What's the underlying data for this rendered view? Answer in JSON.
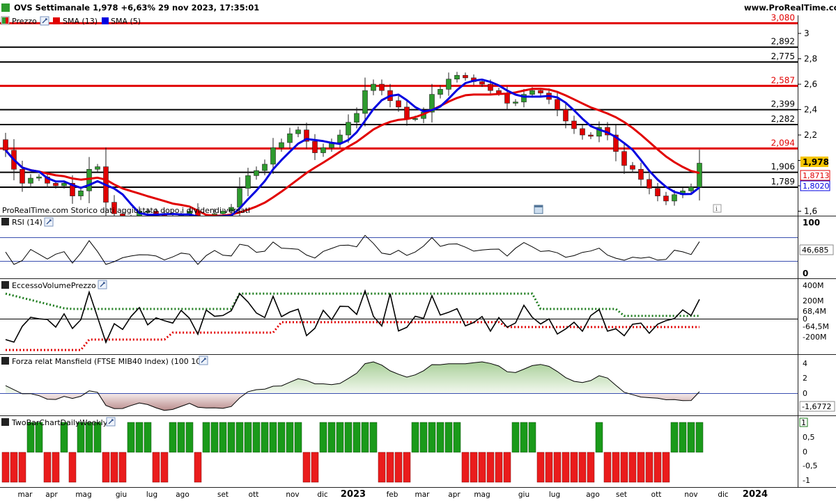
{
  "header": {
    "title": "OVS Settimanale 1,978 +6,63% 29 nov 2023, 17:35:01",
    "site": "www.ProRealTime.com"
  },
  "legend": {
    "price": "Prezzo",
    "sma13": "SMA (13)",
    "sma5": "SMA (5)"
  },
  "watermark": "ProRealTime.com  Storico dati aggiustato dopo i dividendi versati",
  "panels": {
    "rsi": {
      "title": "RSI (14)",
      "top": "100",
      "bottom": "0",
      "value": "46,685"
    },
    "volume": {
      "title": "EccessoVolumePrezzo",
      "ticks": [
        "400M",
        "200M",
        "0",
        "-200M"
      ],
      "upper": "68,4M",
      "lower": "-64,5M"
    },
    "mansfield": {
      "title": "Forza relat Mansfield (FTSE MIB40 Index) (100 10)",
      "ticks": [
        "4",
        "2",
        "0",
        "-2"
      ],
      "value": "-1,6772"
    },
    "twobar": {
      "title": "TwoBarChartDailyWeekly",
      "ticks": [
        "0,5",
        "0",
        "-0,5",
        "-1"
      ],
      "value": "1"
    }
  },
  "axis": {
    "months": [
      {
        "label": "mar",
        "bold": false
      },
      {
        "label": "apr",
        "bold": false
      },
      {
        "label": "mag",
        "bold": false
      },
      {
        "label": "giu",
        "bold": false
      },
      {
        "label": "lug",
        "bold": false
      },
      {
        "label": "ago",
        "bold": false
      },
      {
        "label": "set",
        "bold": false
      },
      {
        "label": "ott",
        "bold": false
      },
      {
        "label": "nov",
        "bold": false
      },
      {
        "label": "dic",
        "bold": false
      },
      {
        "label": "2023",
        "bold": true
      },
      {
        "label": "feb",
        "bold": false
      },
      {
        "label": "mar",
        "bold": false
      },
      {
        "label": "apr",
        "bold": false
      },
      {
        "label": "mag",
        "bold": false
      },
      {
        "label": "giu",
        "bold": false
      },
      {
        "label": "lug",
        "bold": false
      },
      {
        "label": "ago",
        "bold": false
      },
      {
        "label": "set",
        "bold": false
      },
      {
        "label": "ott",
        "bold": false
      },
      {
        "label": "nov",
        "bold": false
      },
      {
        "label": "dic",
        "bold": false
      },
      {
        "label": "2024",
        "bold": true
      }
    ]
  },
  "chart_data": {
    "type": "candlestick",
    "ylim": [
      1.6,
      3.1
    ],
    "yticks": [
      "3",
      "2,8",
      "2,6",
      "2,4",
      "2,2",
      "2",
      "1,8",
      "1,6"
    ],
    "levels": [
      {
        "value": 3.08,
        "label": "3,080",
        "color": "#e10000"
      },
      {
        "value": 2.892,
        "label": "2,892",
        "color": "#000000"
      },
      {
        "value": 2.775,
        "label": "2,775",
        "color": "#000000"
      },
      {
        "value": 2.587,
        "label": "2,587",
        "color": "#e10000"
      },
      {
        "value": 2.399,
        "label": "2,399",
        "color": "#000000"
      },
      {
        "value": 2.282,
        "label": "2,282",
        "color": "#000000"
      },
      {
        "value": 2.094,
        "label": "2,094",
        "color": "#e10000"
      },
      {
        "value": 1.906,
        "label": "1,906",
        "color": "#000000"
      },
      {
        "value": 1.789,
        "label": "1,789",
        "color": "#000000"
      }
    ],
    "last_price": {
      "value": 1.978,
      "label": "1,978"
    },
    "sma13": {
      "value": 1.8713,
      "label": "1,8713",
      "color": "#e10000"
    },
    "sma5": {
      "value": 1.802,
      "label": "1,8020",
      "color": "#0000e0"
    },
    "closes": [
      2.08,
      1.93,
      1.82,
      1.86,
      1.87,
      1.82,
      1.8,
      1.82,
      1.72,
      1.76,
      1.93,
      1.95,
      1.67,
      1.58,
      1.53,
      1.55,
      1.6,
      1.6,
      1.58,
      1.55,
      1.56,
      1.58,
      1.6,
      1.5,
      1.52,
      1.58,
      1.6,
      1.63,
      1.78,
      1.88,
      1.92,
      1.97,
      2.1,
      2.14,
      2.21,
      2.24,
      2.15,
      2.06,
      2.1,
      2.14,
      2.2,
      2.3,
      2.37,
      2.55,
      2.6,
      2.55,
      2.47,
      2.42,
      2.33,
      2.33,
      2.38,
      2.52,
      2.56,
      2.64,
      2.67,
      2.65,
      2.62,
      2.6,
      2.55,
      2.53,
      2.45,
      2.46,
      2.52,
      2.55,
      2.53,
      2.48,
      2.4,
      2.31,
      2.25,
      2.2,
      2.19,
      2.26,
      2.2,
      2.07,
      1.96,
      1.93,
      1.85,
      1.78,
      1.72,
      1.68,
      1.73,
      1.76,
      1.79,
      1.978
    ]
  }
}
